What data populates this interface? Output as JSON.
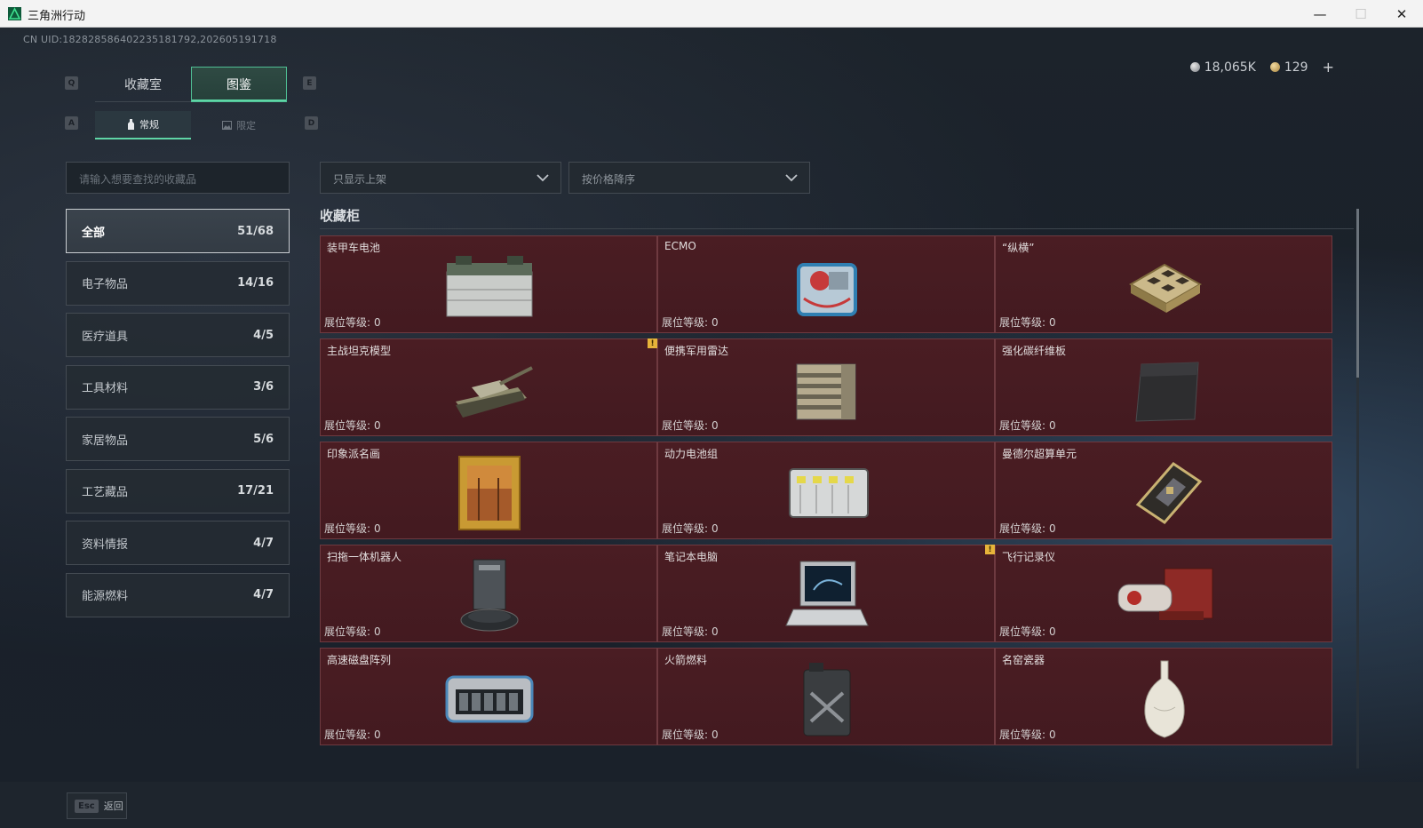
{
  "window": {
    "title": "三角洲行动",
    "min_glyph": "—",
    "max_glyph": "☐",
    "close_glyph": "✕"
  },
  "uid_text": "CN UID:18282858640223518179​2,202605191718",
  "currency": {
    "silver": "18,065K",
    "gold": "129",
    "add": "+"
  },
  "keyhints": {
    "prev_tab": "Q",
    "next_tab": "E",
    "prev_sub": "A",
    "next_sub": "D"
  },
  "tabs": [
    {
      "label": "收藏室"
    },
    {
      "label": "图鉴"
    }
  ],
  "subtabs": [
    {
      "label": "常规"
    },
    {
      "label": "限定"
    }
  ],
  "search": {
    "placeholder": "请输入想要查找的收藏品"
  },
  "filters": {
    "shelf_filter": "只显示上架",
    "sort": "按价格降序"
  },
  "categories": [
    {
      "label": "全部",
      "count": "51/68"
    },
    {
      "label": "电子物品",
      "count": "14/16"
    },
    {
      "label": "医疗道具",
      "count": "4/5"
    },
    {
      "label": "工具材料",
      "count": "3/6"
    },
    {
      "label": "家居物品",
      "count": "5/6"
    },
    {
      "label": "工艺藏品",
      "count": "17/21"
    },
    {
      "label": "资料情报",
      "count": "4/7"
    },
    {
      "label": "能源燃料",
      "count": "4/7"
    }
  ],
  "section_title": "收藏柜",
  "level_label": "展位等级:",
  "items": [
    {
      "name": "装甲车电池",
      "level": "0",
      "icon": "battery-icon"
    },
    {
      "name": "ECMO",
      "level": "0",
      "icon": "ecmo-machine-icon"
    },
    {
      "name": "“纵横”",
      "level": "0",
      "icon": "chessboard-icon"
    },
    {
      "name": "主战坦克模型",
      "level": "0",
      "icon": "tank-model-icon",
      "warn": "!"
    },
    {
      "name": "便携军用雷达",
      "level": "0",
      "icon": "radar-icon"
    },
    {
      "name": "强化碳纤维板",
      "level": "0",
      "icon": "carbon-plate-icon"
    },
    {
      "name": "印象派名画",
      "level": "0",
      "icon": "painting-icon"
    },
    {
      "name": "动力电池组",
      "level": "0",
      "icon": "battery-pack-icon"
    },
    {
      "name": "曼德尔超算单元",
      "level": "0",
      "icon": "supercomputer-unit-icon"
    },
    {
      "name": "扫拖一体机器人",
      "level": "0",
      "icon": "robot-vacuum-icon"
    },
    {
      "name": "笔记本电脑",
      "level": "0",
      "icon": "laptop-icon",
      "warn": "!"
    },
    {
      "name": "飞行记录仪",
      "level": "0",
      "icon": "flight-recorder-icon"
    },
    {
      "name": "高速磁盘阵列",
      "level": "0",
      "icon": "disk-array-icon"
    },
    {
      "name": "火箭燃料",
      "level": "0",
      "icon": "fuel-can-icon"
    },
    {
      "name": "名窑瓷器",
      "level": "0",
      "icon": "porcelain-vase-icon"
    }
  ],
  "bottom": {
    "esc_key": "Esc",
    "back": "返回"
  }
}
